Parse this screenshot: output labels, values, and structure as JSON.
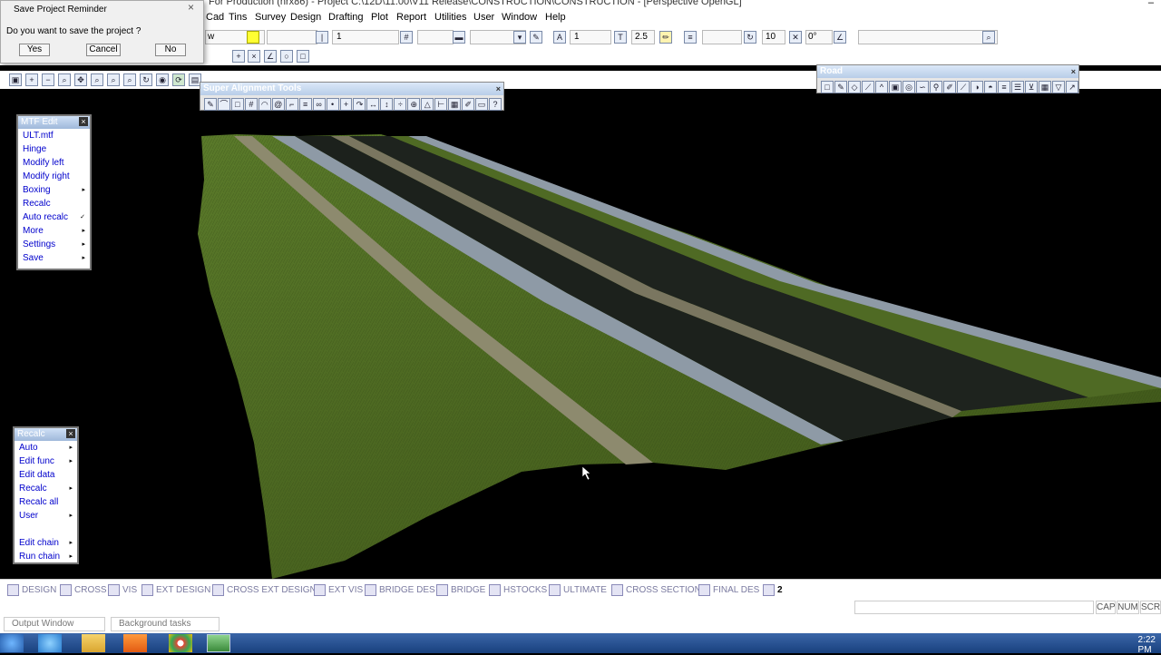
{
  "window": {
    "title": "For Production (nrx86) - Project C:\\12D\\11.00\\V11 Release\\CONSTRUCTION\\CONSTRUCTION - [Perspective OpenGL]"
  },
  "menu": [
    "Cad",
    "Tins",
    "Survey",
    "Design",
    "Drafting",
    "Plot",
    "Report",
    "Utilities",
    "User",
    "Window",
    "Help"
  ],
  "toolbar1": {
    "partial_text": "w",
    "line_value": "1",
    "weight_value": "1",
    "text_size_label": "T",
    "text_size_value": "2.5",
    "angle_value_a": "10",
    "angle_value_b": "0°"
  },
  "save_dialog": {
    "title": "Save Project Reminder",
    "close": "×",
    "message": "Do you want to save the project ?",
    "yes": "Yes",
    "cancel": "Cancel",
    "no": "No"
  },
  "super_alignment_tools": {
    "title": "Super Alignment Tools",
    "close": "×",
    "help_icon": "?"
  },
  "road_toolbar": {
    "title": "Road",
    "close": "×"
  },
  "mtf_panel": {
    "title": "MTF Edit",
    "close": "×",
    "items": [
      {
        "label": "ULT.mtf",
        "arrow": ""
      },
      {
        "label": "Hinge",
        "arrow": ""
      },
      {
        "label": "Modify left",
        "arrow": ""
      },
      {
        "label": "Modify right",
        "arrow": ""
      },
      {
        "label": "Boxing",
        "arrow": "▸"
      },
      {
        "label": "Recalc",
        "arrow": ""
      },
      {
        "label": "Auto recalc",
        "arrow": "✓"
      },
      {
        "label": "More",
        "arrow": "▸"
      },
      {
        "label": "Settings",
        "arrow": "▸"
      },
      {
        "label": "Save",
        "arrow": "▸"
      }
    ]
  },
  "recalc_panel": {
    "title": "Recalc",
    "close": "×",
    "items": [
      {
        "label": "Auto",
        "arrow": "▸"
      },
      {
        "label": "Edit func",
        "arrow": "▸"
      },
      {
        "label": "Edit data",
        "arrow": ""
      },
      {
        "label": "Recalc",
        "arrow": "▸"
      },
      {
        "label": "Recalc all",
        "arrow": ""
      },
      {
        "label": "User",
        "arrow": "▸"
      },
      {
        "label": "",
        "arrow": ""
      },
      {
        "label": "Edit chain",
        "arrow": "▸"
      },
      {
        "label": "Run chain",
        "arrow": "▸"
      }
    ]
  },
  "view_tabs": [
    {
      "label": "DESIGN"
    },
    {
      "label": "CROSS"
    },
    {
      "label": "VIS"
    },
    {
      "label": "EXT DESIGN"
    },
    {
      "label": "CROSS EXT DESIGN"
    },
    {
      "label": "EXT VIS"
    },
    {
      "label": "BRIDGE DES"
    },
    {
      "label": "BRIDGE"
    },
    {
      "label": "HSTOCKS"
    },
    {
      "label": "ULTIMATE"
    },
    {
      "label": "CROSS SECTION"
    },
    {
      "label": "FINAL DES"
    },
    {
      "label": "2"
    }
  ],
  "status": {
    "cap": "CAP",
    "num": "NUM",
    "scrl": "SCRL"
  },
  "output_tabs": {
    "output": "Output Window",
    "background": "Background tasks"
  },
  "clock": "2:22 PM",
  "colors": {
    "grass": "#4f6a24",
    "asphalt": "#1c211c",
    "concrete": "#8d8a6e",
    "kerb": "#8e9aa6",
    "taskbar": "#1f4a8c"
  }
}
